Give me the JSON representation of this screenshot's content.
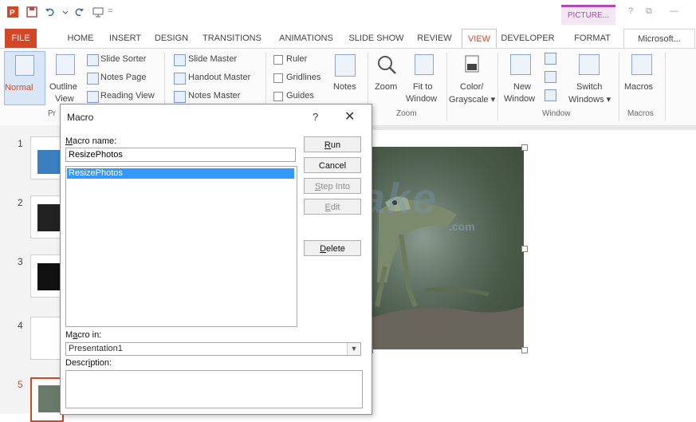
{
  "titlebar": {
    "context_tab": "PICTURE...",
    "help": "?",
    "restore": "⧉",
    "minimize": "—"
  },
  "tabs": [
    "FILE",
    "HOME",
    "INSERT",
    "DESIGN",
    "TRANSITIONS",
    "ANIMATIONS",
    "SLIDE SHOW",
    "REVIEW",
    "VIEW",
    "DEVELOPER",
    "FORMAT",
    "Microsoft..."
  ],
  "ribbon": {
    "normal": "Normal",
    "outline_1": "Outline",
    "outline_2": "View",
    "slide_sorter": "Slide Sorter",
    "notes_page": "Notes Page",
    "reading_view": "Reading View",
    "slide_master": "Slide Master",
    "handout_master": "Handout Master",
    "notes_master": "Notes Master",
    "ruler": "Ruler",
    "gridlines": "Gridlines",
    "guides": "Guides",
    "notes": "Notes",
    "zoom": "Zoom",
    "fit_1": "Fit to",
    "fit_2": "Window",
    "color_1": "Color/",
    "color_2": "Grayscale ▾",
    "new_window_1": "New",
    "new_window_2": "Window",
    "switch_1": "Switch",
    "switch_2": "Windows ▾",
    "macros": "Macros",
    "groups": {
      "presentation_views": "Pr",
      "zoom": "Zoom",
      "window": "Window",
      "macros": "Macros"
    }
  },
  "slides": [
    "1",
    "2",
    "3",
    "4",
    "5"
  ],
  "dialog": {
    "title": "Macro",
    "help": "?",
    "close": "✕",
    "name_label_u": "M",
    "name_label_rest": "acro name:",
    "name_value": "ResizePhotos",
    "list_items": [
      "ResizePhotos"
    ],
    "buttons": {
      "run_u": "R",
      "run_rest": "un",
      "cancel": "Cancel",
      "step_u": "S",
      "step_rest": "tep Into",
      "edit_u": "E",
      "edit_rest": "dit",
      "delete_u": "D",
      "delete_rest": "elete"
    },
    "macro_in_label_a": "M",
    "macro_in_label_u": "a",
    "macro_in_label_rest": "cro in:",
    "macro_in_value": "Presentation1",
    "desc_label_a": "Descr",
    "desc_label_u": "i",
    "desc_label_rest": "ption:"
  },
  "watermark": {
    "text": "TipsMake",
    "suffix": ".com"
  },
  "colors": {
    "accent": "#d24726",
    "picture_tools": "#b04ab6",
    "selection": "#3399ff"
  }
}
